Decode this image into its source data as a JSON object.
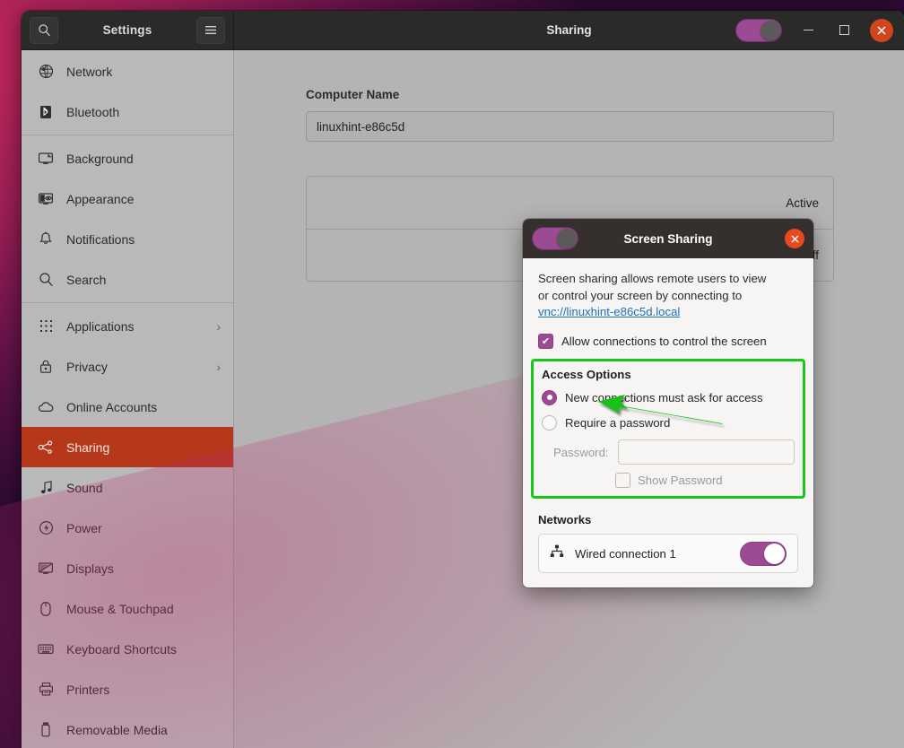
{
  "window": {
    "app_title": "Settings",
    "page_title": "Sharing",
    "search_icon": "search-icon",
    "menu_icon": "hamburger-menu-icon",
    "master_toggle_state": "off",
    "minimize_label": "Minimize",
    "maximize_label": "Maximize",
    "close_label": "Close"
  },
  "sidebar": {
    "items": [
      {
        "label": "Network",
        "icon": "globe-icon",
        "selected": false,
        "submenu": false
      },
      {
        "label": "Bluetooth",
        "icon": "bluetooth-icon",
        "selected": false,
        "submenu": false
      },
      {
        "label": "Background",
        "icon": "monitor-image-icon",
        "selected": false,
        "submenu": false,
        "separator_before": true
      },
      {
        "label": "Appearance",
        "icon": "appearance-icon",
        "selected": false,
        "submenu": false
      },
      {
        "label": "Notifications",
        "icon": "bell-icon",
        "selected": false,
        "submenu": false
      },
      {
        "label": "Search",
        "icon": "search-icon",
        "selected": false,
        "submenu": false
      },
      {
        "label": "Applications",
        "icon": "grid-dots-icon",
        "selected": false,
        "submenu": true,
        "separator_before": true
      },
      {
        "label": "Privacy",
        "icon": "lock-icon",
        "selected": false,
        "submenu": true
      },
      {
        "label": "Online Accounts",
        "icon": "cloud-icon",
        "selected": false,
        "submenu": false
      },
      {
        "label": "Sharing",
        "icon": "share-nodes-icon",
        "selected": true,
        "submenu": false
      },
      {
        "label": "Sound",
        "icon": "music-note-icon",
        "selected": false,
        "submenu": false
      },
      {
        "label": "Power",
        "icon": "power-bolt-icon",
        "selected": false,
        "submenu": false
      },
      {
        "label": "Displays",
        "icon": "display-icon",
        "selected": false,
        "submenu": false
      },
      {
        "label": "Mouse & Touchpad",
        "icon": "mouse-icon",
        "selected": false,
        "submenu": false
      },
      {
        "label": "Keyboard Shortcuts",
        "icon": "keyboard-icon",
        "selected": false,
        "submenu": false
      },
      {
        "label": "Printers",
        "icon": "printer-icon",
        "selected": false,
        "submenu": false
      },
      {
        "label": "Removable Media",
        "icon": "usb-drive-icon",
        "selected": false,
        "submenu": false
      }
    ],
    "submenu_chevron": "›"
  },
  "content": {
    "computer_name_label": "Computer Name",
    "computer_name_value": "linuxhint-e86c5d",
    "rows": [
      {
        "label": "",
        "value": "Active"
      },
      {
        "label": "",
        "value": "Off"
      }
    ]
  },
  "dialog": {
    "title": "Screen Sharing",
    "toggle_state": "off",
    "close_glyph": "✕",
    "description_line1": "Screen sharing allows remote users to view",
    "description_line2": "or control your screen by connecting to",
    "link_text": "vnc://linuxhint-e86c5d.local",
    "allow_control_label": "Allow connections to control the screen",
    "allow_control_checked": true,
    "check_glyph": "✔",
    "access_options": {
      "title": "Access Options",
      "option_ask_label": "New connections must ask for access",
      "option_ask_selected": true,
      "option_password_label": "Require a password",
      "option_password_selected": false,
      "password_label": "Password:",
      "password_value": "",
      "password_placeholder": "",
      "show_password_label": "Show Password",
      "show_password_checked": false
    },
    "networks": {
      "title": "Networks",
      "items": [
        {
          "name": "Wired connection 1",
          "icon": "wired-network-icon",
          "toggle_state": "on"
        }
      ]
    }
  },
  "annotation": {
    "arrow_color": "#18c218",
    "highlight_color": "#19c619"
  }
}
